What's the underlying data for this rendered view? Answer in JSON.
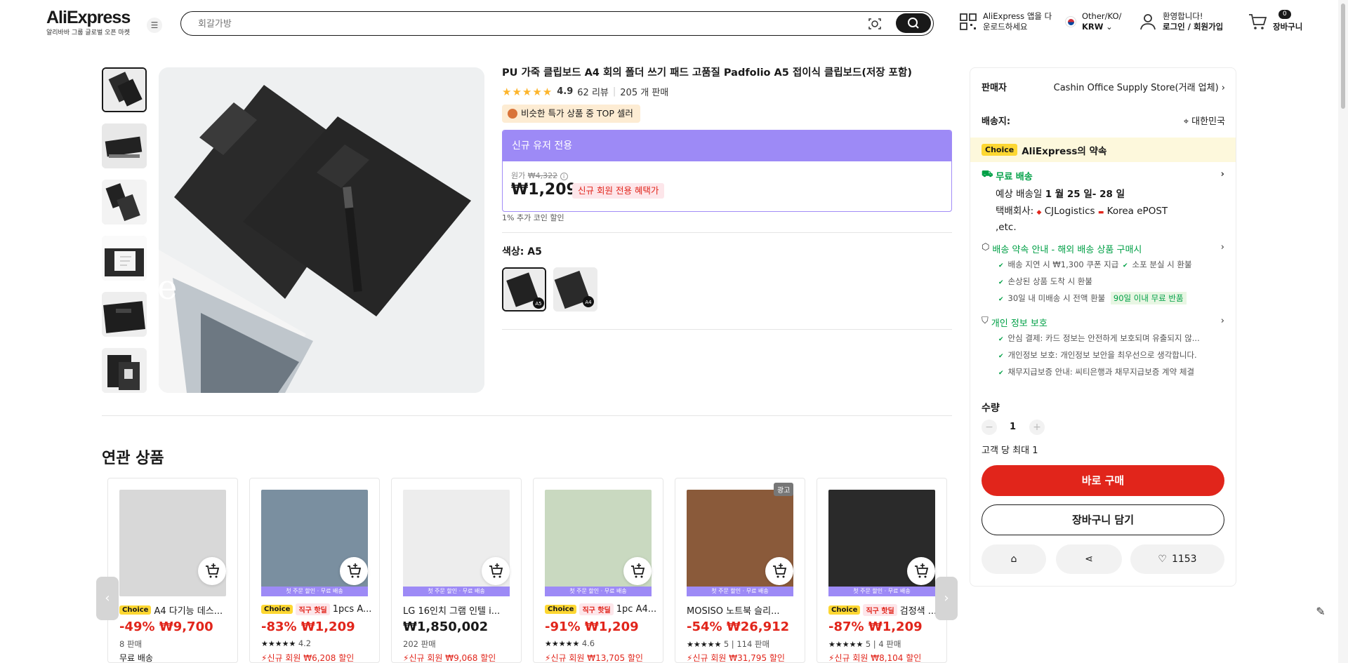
{
  "header": {
    "brand": "AliExpress",
    "tagline": "알리바바 그룹 글로벌 오픈 마켓",
    "search_placeholder": "회갈가방",
    "app_line1": "AliExpress 앱을 다",
    "app_line2": "운로드하세요",
    "locale_line1": "Other/KO/",
    "locale_line2": "KRW",
    "account_line1": "환영합니다!",
    "account_line2": "로그인 / 회원가입",
    "cart_count": "0",
    "cart_label": "장바구니"
  },
  "product": {
    "title": "PU 가죽 클립보드 A4 회의 폴더 쓰기 패드 고품질 Padfolio A5 접이식 클립보드(저장 포함)",
    "rating": "4.9",
    "reviews": "62 리뷰",
    "sold": "205 개 판매",
    "top_badge": "비슷한 특가 상품 중 TOP 셀러",
    "price_header": "신규 유저 전용",
    "orig_label": "원가",
    "orig_price": "₩4,322",
    "price": "₩1,209",
    "new_member_badge": "신규 회원 전용 혜택가",
    "coin_text": "1% 추가 코인 할인",
    "color_label": "색상: A5",
    "swatches": [
      "A5",
      "A4"
    ]
  },
  "related": {
    "title": "연관 상품",
    "cards": [
      {
        "choice": "Choice",
        "hot": "",
        "name": "A4 다기능 데스...",
        "discount": "-49%",
        "price": "₩9,700",
        "meta": "8 판매",
        "promo": "무료 배송",
        "promo_black": true,
        "ship_bar": "",
        "ad": ""
      },
      {
        "choice": "Choice",
        "hot": "직구 핫딜",
        "name": "1pcs A...",
        "discount": "-83%",
        "price": "₩1,209",
        "meta": "4.2",
        "promo": "신규 회원 ₩6,208 할인",
        "promo_black": false,
        "ship_bar": "첫 주문 할인 · 무료 배송",
        "ad": ""
      },
      {
        "choice": "",
        "hot": "",
        "name": "LG 16인치 그램 인텔 i...",
        "discount": "",
        "price": "₩1,850,002",
        "meta": "202 판매",
        "promo": "신규 회원 ₩9,068 할인",
        "promo_black": false,
        "ship_bar": "첫 주문 할인 · 무료 배송",
        "ad": ""
      },
      {
        "choice": "Choice",
        "hot": "직구 핫딜",
        "name": "1pc A4...",
        "discount": "-91%",
        "price": "₩1,209",
        "meta": "4.6",
        "promo": "신규 회원 ₩13,705 할인",
        "promo_black": false,
        "ship_bar": "첫 주문 할인 · 무료 배송",
        "ad": ""
      },
      {
        "choice": "",
        "hot": "",
        "name": "MOSISO 노트북 슬리...",
        "discount": "-54%",
        "price": "₩26,912",
        "meta": "5 | 114 판매",
        "promo": "신규 회원 ₩31,795 할인",
        "promo_black": false,
        "ship_bar": "첫 주문 할인 · 무료 배송",
        "ad": "광고"
      },
      {
        "choice": "Choice",
        "hot": "직구 핫딜",
        "name": "검정색 ...",
        "discount": "-87%",
        "price": "₩1,209",
        "meta": "5 | 4 판매",
        "promo": "신규 회원 ₩8,104 할인",
        "promo_black": false,
        "ship_bar": "첫 주문 할인 · 무료 배송",
        "ad": ""
      }
    ]
  },
  "panel": {
    "seller_label": "판매자",
    "seller_name": "Cashin Office Supply Store(거래 업체)",
    "ship_to_label": "배송지:",
    "ship_to_value": "대한민국",
    "choice_tag": "Choice",
    "choice_promise": "AliExpress의 약속",
    "free_shipping": "무료 배송",
    "delivery_prefix": "예상 배송일 ",
    "delivery_date": "1 월 25 일- 28 일",
    "carrier_label": "택배회사:",
    "carrier_1": "CJLogistics",
    "carrier_2": "Korea",
    "carrier_3": "ePOST ,etc.",
    "promise_title": "배송 약속 안내 - 해외 배송 상품 구매시",
    "promise_1": "배송 지연 시 ₩1,300 쿠폰 지급",
    "promise_2": "소포 분실 시 환불",
    "promise_3": "손상된 상품 도착 시 환불",
    "promise_4": "30일 내 미배송 시 전액 환불",
    "promise_4_badge": "90일 이내 무료 반품",
    "privacy_title": "개인 정보 보호",
    "privacy_1": "안심 결제: 카드 정보는 안전하게 보호되며 유출되지 않...",
    "privacy_2": "개인정보 보호: 개인정보 보안을 최우선으로 생각합니다.",
    "privacy_3": "채무지급보증 안내: 씨티은행과 채무지급보증 계약 체결",
    "qty_label": "수량",
    "qty_value": "1",
    "qty_limit": "고객 당 최대 1",
    "buy_now": "바로 구매",
    "add_to_cart": "장바구니 담기",
    "wishlist_count": "1153"
  },
  "colors": {
    "accent": "#e1251b",
    "purple": "#9d8af6",
    "choice_yellow": "#fdd732",
    "green": "#00a046"
  }
}
